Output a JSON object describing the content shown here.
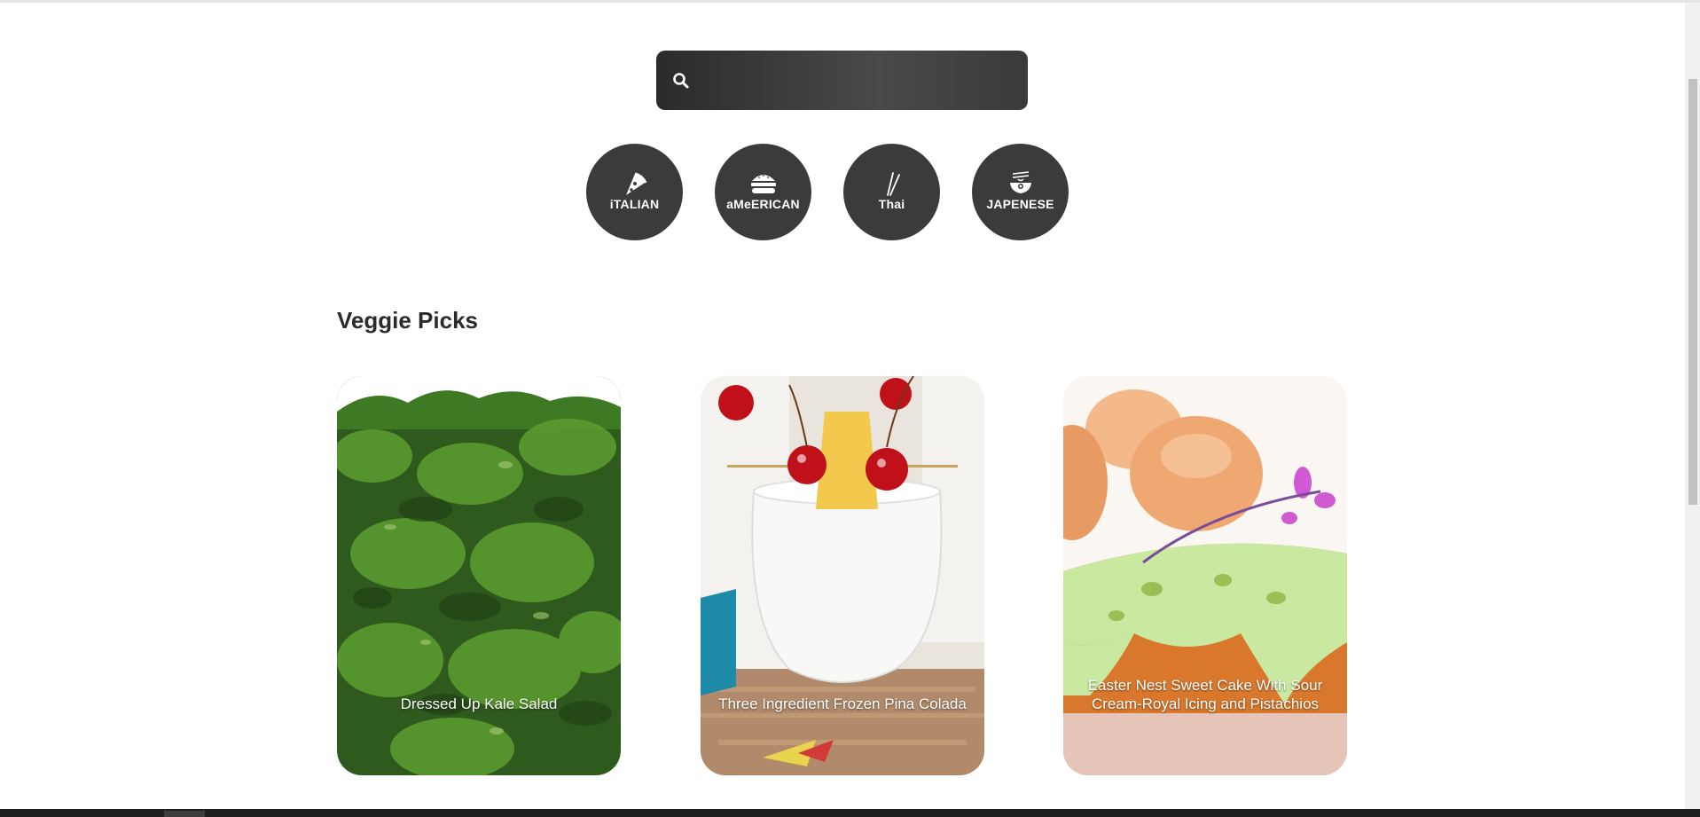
{
  "search": {
    "placeholder": "",
    "value": ""
  },
  "categories": [
    {
      "label": "iTALIAN",
      "icon": "pizza-icon"
    },
    {
      "label": "aMeERICAN",
      "icon": "burger-icon"
    },
    {
      "label": "Thai",
      "icon": "chopsticks-icon"
    },
    {
      "label": "JAPENESE",
      "icon": "ramen-bowl-icon"
    }
  ],
  "section": {
    "title": "Veggie Picks"
  },
  "cards": [
    {
      "title": "Dressed Up Kale Salad"
    },
    {
      "title": "Three Ingredient Frozen Pina Colada"
    },
    {
      "title": "Easter Nest Sweet Cake With Sour Cream-Royal Icing and Pistachios"
    }
  ],
  "colors": {
    "search_bg": "#3a3a3a",
    "category_bg": "#3b3b3b",
    "text_dark": "#2b2b2b"
  }
}
